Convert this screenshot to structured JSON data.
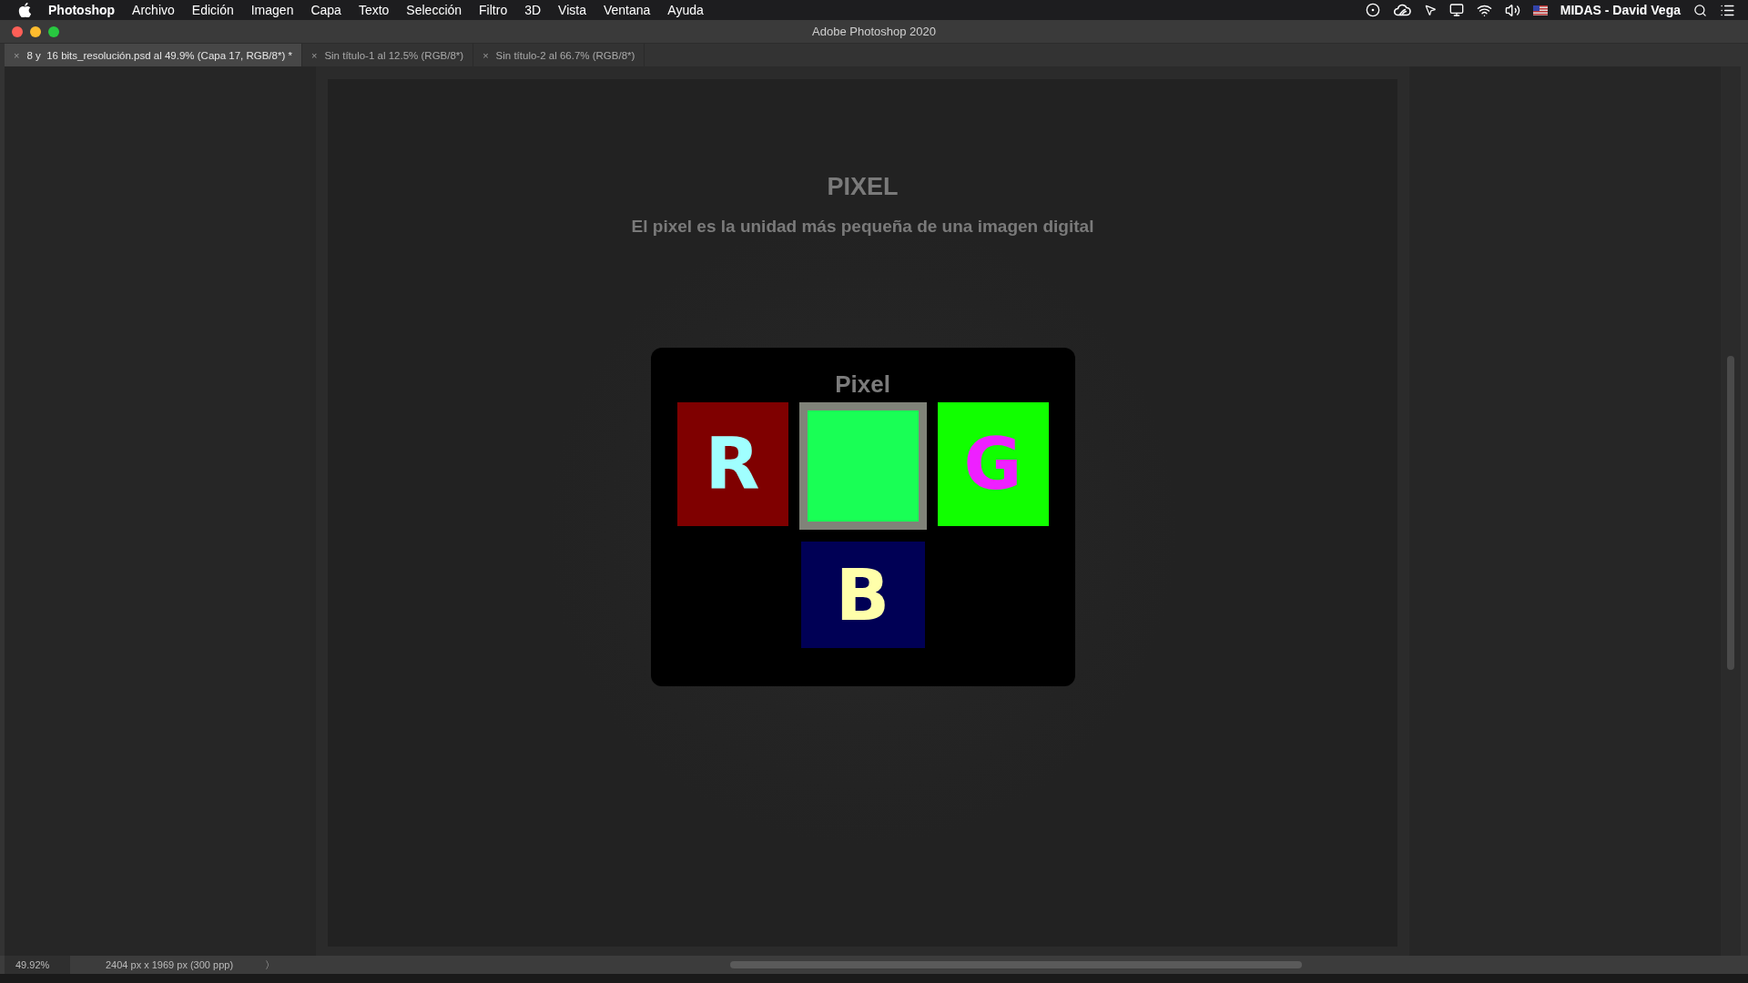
{
  "menu_bar": {
    "app_name": "Photoshop",
    "items": [
      "Archivo",
      "Edición",
      "Imagen",
      "Capa",
      "Texto",
      "Selección",
      "Filtro",
      "3D",
      "Vista",
      "Ventana",
      "Ayuda"
    ],
    "user": "MIDAS - David Vega"
  },
  "window": {
    "title": "Adobe Photoshop 2020"
  },
  "tabs": [
    {
      "label": "8 y  16 bits_resolución.psd al 49.9% (Capa 17, RGB/8*) *",
      "close": "×",
      "selected": true
    },
    {
      "label": "Sin título-1 al 12.5% (RGB/8*)",
      "close": "×",
      "selected": false
    },
    {
      "label": "Sin título-2 al 66.7% (RGB/8*)",
      "close": "×",
      "selected": false
    }
  ],
  "document": {
    "heading": "PIXEL",
    "subtitle": "El pixel es la unidad más pequeña de una imagen digital",
    "card_title": "Pixel",
    "tiles": [
      {
        "kind": "channel",
        "letter": "R",
        "color": "#7f0000"
      },
      {
        "kind": "result",
        "color": "#19ff55"
      },
      {
        "kind": "channel",
        "letter": "G",
        "color": "#11ff00"
      },
      {
        "kind": "channel",
        "letter": "B",
        "color": "#000055"
      }
    ]
  },
  "status_bar": {
    "zoom": "49.92%",
    "dimensions": "2404 px x 1969 px (300 ppp)",
    "arrow": "〉"
  }
}
